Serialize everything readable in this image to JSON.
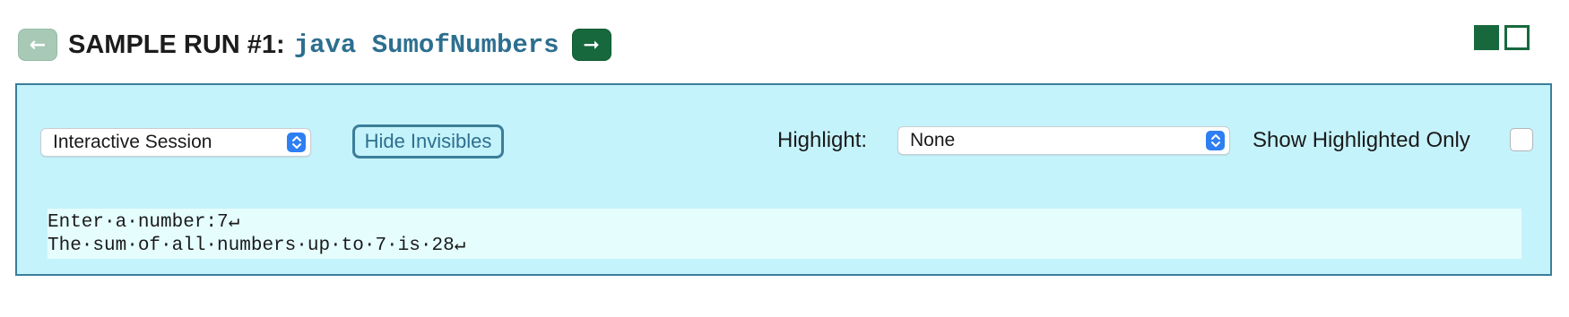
{
  "header": {
    "prev_icon": "arrow-left-icon",
    "prev_glyph": "←",
    "title_prefix": "SAMPLE RUN #1:",
    "command": "java SumofNumbers",
    "next_icon": "arrow-right-icon",
    "next_glyph": "➞"
  },
  "view_toggle": {
    "filled_icon": "square-filled-icon",
    "outline_icon": "square-outline-icon"
  },
  "controls": {
    "session_select_value": "Interactive Session",
    "hide_invisibles_label": "Hide Invisibles",
    "highlight_label": "Highlight:",
    "highlight_select_value": "None",
    "show_highlighted_label": "Show Highlighted Only",
    "show_highlighted_checked": false
  },
  "output": {
    "lines": [
      "Enter·a·number:7↵",
      "The·sum·of·all·numbers·up·to·7·is·28↵"
    ]
  },
  "colors": {
    "accent": "#17693d",
    "accent_disabled": "#a7c9b6",
    "panel_bg": "#c5f3fb",
    "panel_border": "#3b7e99",
    "output_bg": "#e6fdfe",
    "link": "#2d6f8f",
    "select_chevron": "#2d7ff2"
  }
}
